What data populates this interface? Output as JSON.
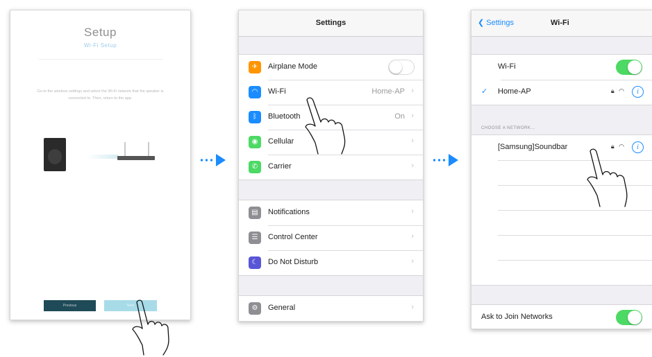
{
  "setup_screen": {
    "title": "Setup",
    "subtitle": "Wi-Fi Setup",
    "instruction": "Go to the wireless settings and select the Wi-Fi network that the speaker is connected to. Then, return to the app.",
    "prev_button": "Previous",
    "next_button": "Next"
  },
  "settings_screen": {
    "title": "Settings",
    "group1": [
      {
        "label": "Airplane Mode",
        "icon": "airplane-icon",
        "color": "#ff9500"
      },
      {
        "label": "Wi-Fi",
        "value": "Home-AP",
        "icon": "wifi-icon",
        "color": "#1a8cff"
      },
      {
        "label": "Bluetooth",
        "value": "On",
        "icon": "bluetooth-icon",
        "color": "#1a8cff"
      },
      {
        "label": "Cellular",
        "icon": "cellular-icon",
        "color": "#4cd964"
      },
      {
        "label": "Carrier",
        "icon": "phone-icon",
        "color": "#4cd964"
      }
    ],
    "group2": [
      {
        "label": "Notifications",
        "icon": "notifications-icon",
        "color": "#8e8e93"
      },
      {
        "label": "Control Center",
        "icon": "control-center-icon",
        "color": "#8e8e93"
      },
      {
        "label": "Do Not Disturb",
        "icon": "moon-icon",
        "color": "#5856d6"
      }
    ],
    "group3": [
      {
        "label": "General",
        "icon": "gear-icon",
        "color": "#8e8e93"
      }
    ]
  },
  "wifi_screen": {
    "back_label": "Settings",
    "title": "Wi-Fi",
    "wifi_label": "Wi-Fi",
    "connected_network": "Home-AP",
    "section_header": "CHOOSE A NETWORK...",
    "networks": [
      {
        "name": "[Samsung]Soundbar"
      }
    ],
    "ask_to_join": "Ask to Join Networks"
  },
  "colors": {
    "accent": "#1a8cff",
    "toggle_on": "#4cd964"
  }
}
